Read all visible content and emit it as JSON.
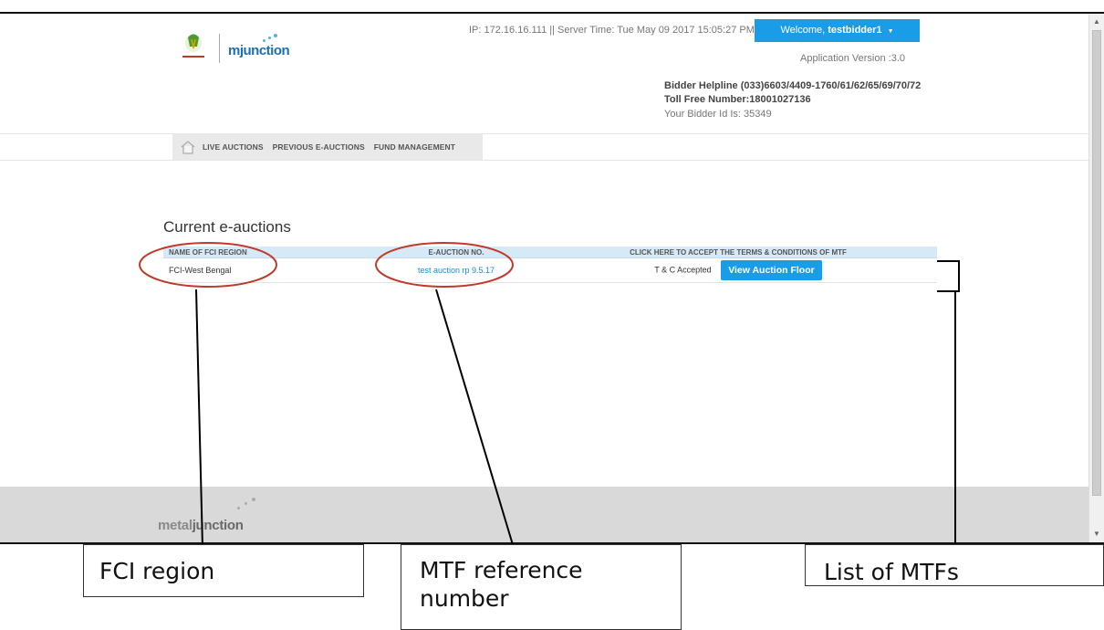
{
  "header": {
    "ip_info": "IP: 172.16.16.111 || Server Time: Tue May 09 2017 15:05:27 PM",
    "welcome_prefix": "Welcome, ",
    "username": "testbidder1",
    "app_version": "Application Version :3.0",
    "helpline": "Bidder Helpline (033)6603/4409-1760/61/62/65/69/70/72",
    "tollfree": "Toll Free Number:18001027136",
    "bidder_id": "Your Bidder Id Is: 35349",
    "logo_text": "mjunction"
  },
  "nav": {
    "items": [
      "LIVE AUCTIONS",
      "PREVIOUS E-AUCTIONS",
      "FUND MANAGEMENT"
    ]
  },
  "main": {
    "title": "Current e-auctions",
    "table": {
      "headers": [
        "NAME OF FCI REGION",
        "E-AUCTION NO.",
        "CLICK HERE TO ACCEPT THE TERMS & CONDITIONS OF MTF"
      ],
      "rows": [
        {
          "region": "FCI-West Bengal",
          "auction_no": "test auction rp 9.5.17",
          "tc_status": "T & C Accepted",
          "action_label": "View Auction Floor"
        }
      ]
    }
  },
  "footer": {
    "logo_metal": "metal",
    "logo_junction": "junction"
  },
  "annotations": {
    "fci_region": "FCI region",
    "mtf_reference": "MTF reference number",
    "list_of_mtfs": "List of MTFs"
  },
  "colors": {
    "accent": "#1a9de8",
    "header_row": "#d5e9f7",
    "footer": "#d9d9d9",
    "annotation_red": "#c0392b"
  }
}
